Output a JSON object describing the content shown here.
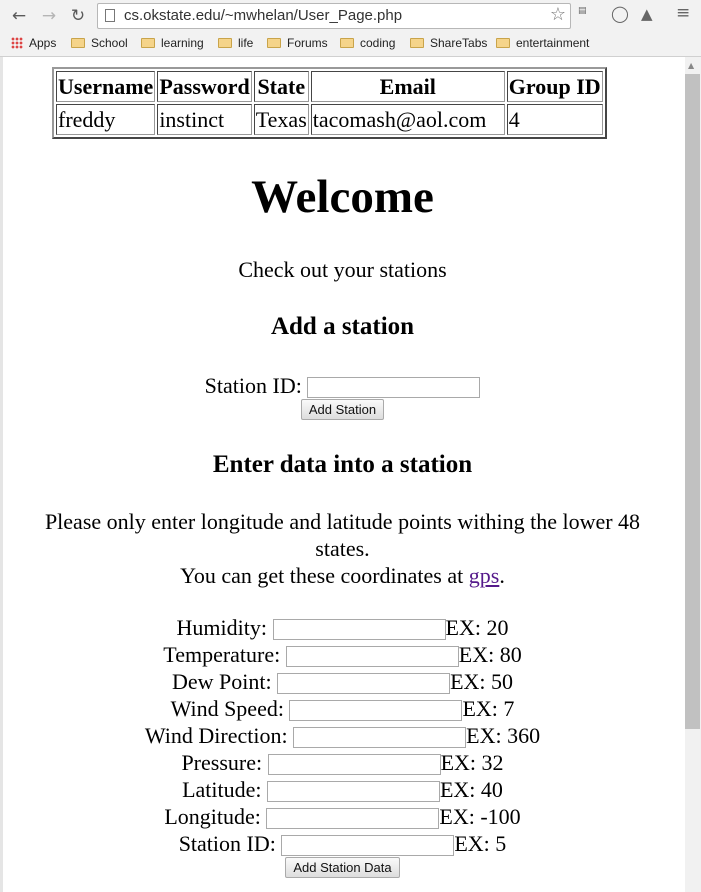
{
  "browser": {
    "url": "cs.okstate.edu/~mwhelan/User_Page.php",
    "bookmarks": [
      "Apps",
      "School",
      "learning",
      "life",
      "Forums",
      "coding",
      "ShareTabs",
      "entertainment"
    ]
  },
  "user_table": {
    "headers": [
      "Username",
      "Password",
      "State",
      "Email",
      "Group ID"
    ],
    "row": [
      "freddy",
      "instinct",
      "Texas",
      "tacomash@aol.com",
      "4"
    ]
  },
  "welcome": {
    "title": "Welcome",
    "subtitle": "Check out your stations"
  },
  "add_station": {
    "heading": "Add a station",
    "label": "Station ID:",
    "button": "Add Station"
  },
  "enter_data": {
    "heading": "Enter data into a station",
    "note_line1": "Please only enter longitude and latitude points withing the lower 48",
    "note_line2": "states.",
    "coords_prefix": "You can get these coordinates at ",
    "coords_link": "gps",
    "coords_suffix": ".",
    "fields": [
      {
        "label": "Humidity:",
        "example": "EX: 20"
      },
      {
        "label": "Temperature:",
        "example": "EX: 80"
      },
      {
        "label": "Dew Point:",
        "example": "EX: 50"
      },
      {
        "label": "Wind Speed:",
        "example": "EX: 7"
      },
      {
        "label": "Wind Direction:",
        "example": "EX: 360"
      },
      {
        "label": "Pressure:",
        "example": "EX: 32"
      },
      {
        "label": "Latitude:",
        "example": "EX: 40"
      },
      {
        "label": "Longitude:",
        "example": "EX: -100"
      },
      {
        "label": "Station ID:",
        "example": "EX: 5"
      }
    ],
    "button": "Add Station Data"
  }
}
